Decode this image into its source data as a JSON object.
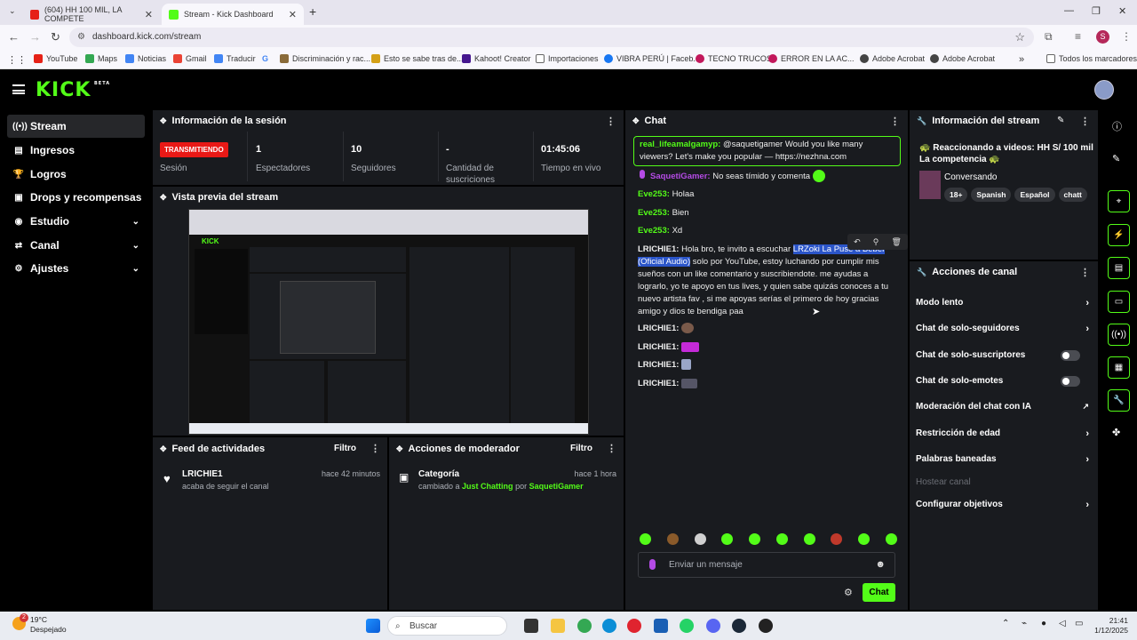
{
  "browser": {
    "tabs": [
      {
        "title": "(604) HH 100 MIL, LA COMPETE",
        "color": "#e62117"
      },
      {
        "title": "Stream - Kick Dashboard",
        "color": "#53fc18"
      }
    ],
    "url": "dashboard.kick.com/stream",
    "profile_initial": "S",
    "bookmarks": [
      {
        "label": "YouTube",
        "color": "#e62117"
      },
      {
        "label": "Maps",
        "color": "#34a853"
      },
      {
        "label": "Noticias",
        "color": "#4285f4"
      },
      {
        "label": "Gmail",
        "color": "#ea4335"
      },
      {
        "label": "Traducir",
        "color": "#4285f4"
      },
      {
        "label": "Discriminación y rac...",
        "color": "#8a6b3a"
      },
      {
        "label": "Esto se sabe tras de...",
        "color": "#d4a017"
      },
      {
        "label": "Kahoot! Creator",
        "color": "#46178f"
      },
      {
        "label": "Importaciones",
        "color": "#666666"
      },
      {
        "label": "VIBRA PERÚ | Faceb...",
        "color": "#1877f2"
      },
      {
        "label": "TECNO TRUCOS",
        "color": "#c2185b"
      },
      {
        "label": "ERROR EN LA AC...",
        "color": "#c2185b"
      },
      {
        "label": "Adobe Acrobat",
        "color": "#444444"
      },
      {
        "label": "Adobe Acrobat",
        "color": "#444444"
      },
      {
        "label": "Todos los marcadores",
        "color": "#666666"
      }
    ]
  },
  "header": {
    "logo": "KICK",
    "logo_badge": "BETA"
  },
  "sidebar": {
    "items": [
      {
        "label": "Stream",
        "icon": "stream-icon"
      },
      {
        "label": "Ingresos",
        "icon": "revenue-icon"
      },
      {
        "label": "Logros",
        "icon": "trophy-icon"
      },
      {
        "label": "Drops y recompensas",
        "icon": "gift-icon"
      },
      {
        "label": "Estudio",
        "icon": "studio-icon"
      },
      {
        "label": "Canal",
        "icon": "channel-icon"
      },
      {
        "label": "Ajustes",
        "icon": "gear-icon"
      }
    ]
  },
  "session": {
    "title": "Información de la sesión",
    "status": "TRANSMITIENDO",
    "status_label": "Sesión",
    "stats": [
      {
        "value": "1",
        "label": "Espectadores"
      },
      {
        "value": "10",
        "label": "Seguidores"
      },
      {
        "value": "-",
        "label": "Cantidad de suscriciones"
      },
      {
        "value": "01:45:06",
        "label": "Tiempo en vivo"
      }
    ]
  },
  "preview": {
    "title": "Vista previa del stream"
  },
  "activity_feed": {
    "title": "Feed de actividades",
    "filter": "Filtro",
    "items": [
      {
        "user": "LRICHIE1",
        "text": "acaba de seguir el canal",
        "time": "hace 42 minutos"
      }
    ]
  },
  "mod_actions": {
    "title": "Acciones de moderador",
    "filter": "Filtro",
    "items": [
      {
        "title": "Categoría",
        "pre": "cambiado a",
        "target": "Just Chatting",
        "by": "por",
        "user": "SaquetiGamer",
        "time": "hace 1 hora"
      }
    ]
  },
  "chat": {
    "title": "Chat",
    "pinned": {
      "user": "real_lifeamalgamyp:",
      "text": "@saquetigamer Would you like many viewers? Let's make you popular — https://nezhna.com"
    },
    "messages": [
      {
        "user": "SaquetiGamer:",
        "text": "No seas tímido y comenta",
        "color": "#b54be6"
      },
      {
        "user": "Eve253:",
        "text": "Holaa",
        "color": "#53fc18"
      },
      {
        "user": "Eve253:",
        "text": "Bien",
        "color": "#53fc18"
      },
      {
        "user": "Eve253:",
        "text": "Xd",
        "color": "#53fc18"
      }
    ],
    "long_msg": {
      "user": "LRICHIE1:",
      "pre": "Hola bro, te invito a escuchar ",
      "highlight": "LRZoki La Puse a Beber (Oficial Audio)",
      "post": " solo por YouTube, estoy luchando por cumplir mis sueños con un like comentario y suscribiendote. me ayudas a lograrlo, yo te apoyo en tus lives, y quien sabe quizás conoces a tu nuevo artista fav , si me apoyas serías el primero de hoy gracias amigo y dios te bendiga paa"
    },
    "emote_msgs": [
      "LRICHIE1:",
      "LRICHIE1:",
      "LRICHIE1:",
      "LRICHIE1:"
    ],
    "input_placeholder": "Enviar un mensaje",
    "send_label": "Chat"
  },
  "stream_info": {
    "title": "Información del stream",
    "stream_title": "🐢 Reaccionando a videos: HH S/ 100 mil La competencia 🐢",
    "category": "Conversando",
    "tags": [
      "18+",
      "Spanish",
      "Español",
      "chatt"
    ]
  },
  "channel_actions": {
    "title": "Acciones de canal",
    "items": [
      {
        "label": "Modo lento",
        "type": "chevron"
      },
      {
        "label": "Chat de solo-seguidores",
        "type": "chevron"
      },
      {
        "label": "Chat de solo-suscriptores",
        "type": "toggle"
      },
      {
        "label": "Chat de solo-emotes",
        "type": "toggle"
      },
      {
        "label": "Moderación del chat con IA",
        "type": "external"
      },
      {
        "label": "Restricción de edad",
        "type": "chevron"
      },
      {
        "label": "Palabras baneadas",
        "type": "chevron"
      },
      {
        "label": "Hostear canal",
        "type": "disabled"
      },
      {
        "label": "Configurar objetivos",
        "type": "chevron"
      }
    ]
  },
  "taskbar": {
    "weather_temp": "19°C",
    "weather_desc": "Despejado",
    "search": "Buscar",
    "weather_badge": "2",
    "time": "21:41",
    "date": "1/12/2025"
  }
}
